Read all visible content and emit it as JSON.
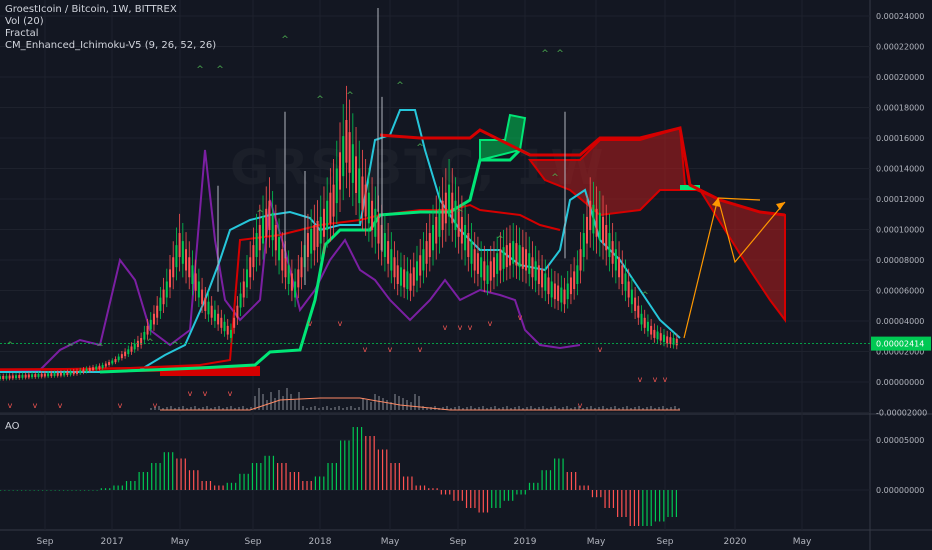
{
  "legend": {
    "title": "GroestIcoin / Bitcoin, 1W, BITTREX",
    "vol": "Vol (20)",
    "fractal": "Fractal",
    "ichimoku": "CM_Enhanced_Ichimoku-V5 (9, 26, 52, 26)"
  },
  "watermark": "GRS BTC, 1W",
  "ao_label": "AO",
  "last_price_label": "0.00002414",
  "colors": {
    "background": "#131722",
    "grid": "#1e222d",
    "up_candle": "#00c853",
    "down_candle": "#ff5252",
    "purple_line": "#7b1fa2",
    "teal_line": "#26a69a",
    "tenkan": "#26c6da",
    "kijun_cloud_bear": "#d50000",
    "cloud_bull": "#00e676",
    "arrow": "#ff9800",
    "price_tag": "#00c853",
    "fractal_up": "#4caf50",
    "fractal_down": "#ef5350"
  },
  "chart_data": [
    {
      "type": "line",
      "name": "price",
      "ylim": [
        -2e-05,
        0.00025
      ],
      "y_ticks": [
        "0.00024000",
        "0.00022000",
        "0.00020000",
        "0.00018000",
        "0.00016000",
        "0.00014000",
        "0.00012000",
        "0.00010000",
        "0.00008000",
        "0.00006000",
        "0.00004000",
        "0.00002000",
        "0.00000000",
        "-0.00002000"
      ],
      "x_ticks": [
        "Sep",
        "2017",
        "May",
        "Sep",
        "2018",
        "May",
        "Sep",
        "2019",
        "May",
        "Sep",
        "2020",
        "May"
      ],
      "last_price": 2.414e-05,
      "series": [
        {
          "values": [
            5e-07,
            1e-06,
            1.5e-06,
            2e-06,
            2.5e-06,
            3e-06,
            4e-06,
            6e-06,
            8e-06,
            1.2e-05,
            1.8e-05,
            2.5e-05,
            4e-05,
            6e-05,
            9e-05,
            7e-05,
            5e-05,
            4e-05,
            3e-05,
            6e-05,
            9e-05,
            0.00011,
            8e-05,
            6e-05,
            9e-05,
            0.0001,
            0.00012,
            0.00016,
            0.00013,
            0.00011,
            9e-05,
            7e-05,
            6.5e-05,
            8e-05,
            0.0001,
            0.00012,
            0.0001,
            8e-05,
            7e-05,
            8e-05,
            8.5e-05,
            8e-05,
            7e-05,
            6e-05,
            5.5e-05,
            7e-05,
            0.00011,
            0.0001,
            8e-05,
            6e-05,
            4e-05,
            3e-05,
            2.6e-05,
            2.4e-05
          ]
        }
      ]
    },
    {
      "type": "bar",
      "name": "AO",
      "y_ticks": [
        "0.00005000",
        "0.00000000"
      ],
      "values": [
        0,
        0,
        0,
        0,
        0,
        0,
        0,
        0,
        2e-06,
        5e-06,
        1e-05,
        2e-05,
        3e-05,
        4.2e-05,
        3.5e-05,
        2.2e-05,
        1e-05,
        5e-06,
        8e-06,
        1.8e-05,
        3e-05,
        3.8e-05,
        3e-05,
        2e-05,
        1e-05,
        1.5e-05,
        3e-05,
        5.5e-05,
        7e-05,
        6e-05,
        4.5e-05,
        3e-05,
        1.5e-05,
        5e-06,
        2e-06,
        -5e-06,
        -1.2e-05,
        -2e-05,
        -2.5e-05,
        -2e-05,
        -1.2e-05,
        -5e-06,
        8e-06,
        2.2e-05,
        3.5e-05,
        2e-05,
        5e-06,
        -8e-06,
        -2e-05,
        -3e-05,
        -4e-05,
        -4e-05,
        -3.5e-05,
        -3e-05
      ]
    }
  ]
}
